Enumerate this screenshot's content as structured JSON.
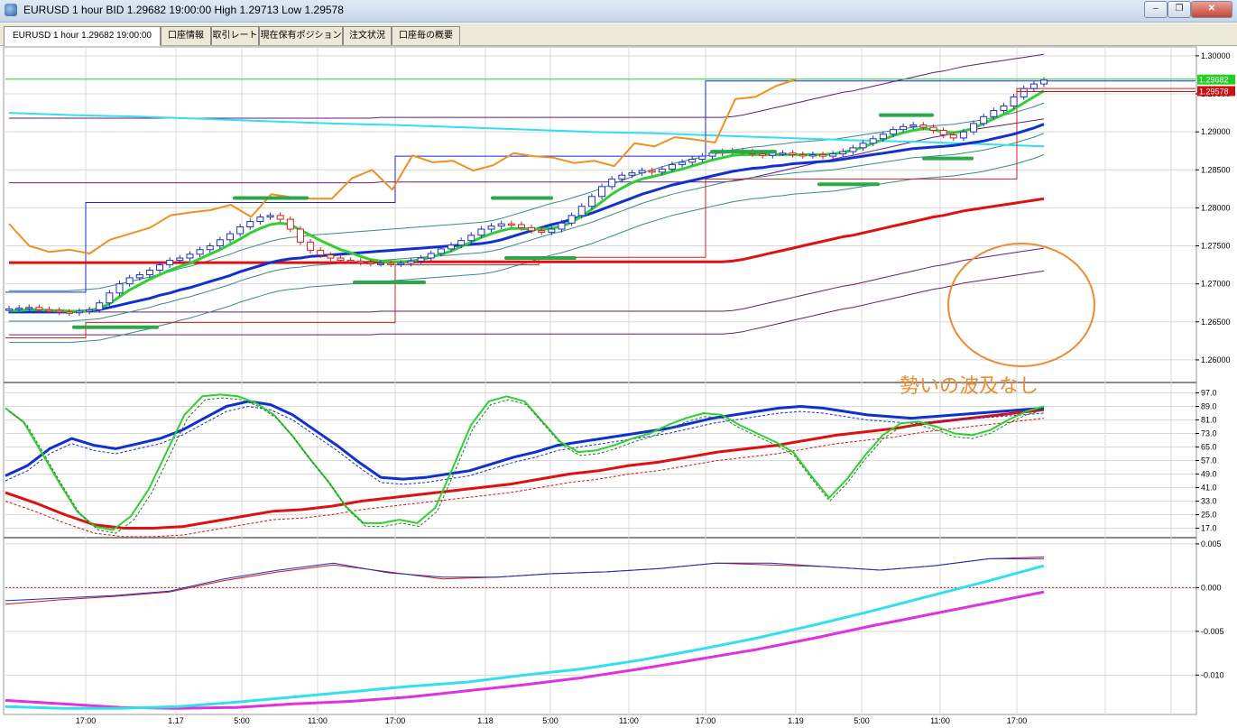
{
  "window": {
    "title": "EURUSD 1 hour BID 1.29682 19:00:00 High 1.29713 Low 1.29578",
    "minimize_icon": "minimize-icon",
    "restore_icon": "restore-icon",
    "close_icon": "close-icon"
  },
  "tabs": [
    {
      "label": "EURUSD 1 hour 1.29682 19:00:00",
      "active": true
    },
    {
      "label": "口座情報"
    },
    {
      "label": "取引レート"
    },
    {
      "label": "現在保有ポジション"
    },
    {
      "label": "注文状況"
    },
    {
      "label": "口座毎の概要"
    }
  ],
  "colors": {
    "background": "#ffffff",
    "grid": "#d8d8d8",
    "bull_candle": "#2030c8",
    "bear_candle": "#d02020",
    "price_line_green": "#20d020",
    "ask_line_red": "#d01010",
    "annotation": "#f08a30",
    "sma_fast": "#30d030",
    "sma_mid": "#1030d0",
    "sma_slow": "#e01010",
    "envelope": "#6a1a7a",
    "cyan": "#30e0f0",
    "magenta": "#e030e0",
    "chikou": "#f09020"
  },
  "annotation": {
    "text": "勢いの波及なし"
  },
  "chart_data": [
    {
      "type": "line",
      "panel": "price",
      "subtype": "candlestick",
      "symbol": "EURUSD",
      "timeframe": "1 hour",
      "last_close": 1.29682,
      "ask": 1.29578,
      "price_labels": [
        "1.29682",
        "1.29578"
      ],
      "ylim": [
        1.2575,
        1.3007
      ],
      "yticks": [
        "1.30000",
        "1.29500",
        "1.29000",
        "1.28500",
        "1.28000",
        "1.27500",
        "1.27000",
        "1.26500",
        "1.26000"
      ],
      "xticks": [
        "17:00",
        "1.17",
        "5:00",
        "11:00",
        "17:00",
        "1.18",
        "5:00",
        "11:00",
        "17:00",
        "1.19",
        "5:00",
        "11:00",
        "17:00"
      ],
      "candles_close": [
        1.2667,
        1.2668,
        1.2669,
        1.2666,
        1.2665,
        1.2663,
        1.2662,
        1.2664,
        1.2666,
        1.2675,
        1.2688,
        1.27,
        1.2708,
        1.2712,
        1.2718,
        1.2725,
        1.2731,
        1.2734,
        1.2739,
        1.2745,
        1.275,
        1.2758,
        1.2766,
        1.2775,
        1.2782,
        1.2788,
        1.279,
        1.2785,
        1.2772,
        1.2755,
        1.2744,
        1.2738,
        1.2734,
        1.2731,
        1.273,
        1.2728,
        1.2727,
        1.2727,
        1.2726,
        1.2727,
        1.273,
        1.2734,
        1.274,
        1.2746,
        1.2751,
        1.2757,
        1.2764,
        1.2772,
        1.2776,
        1.2779,
        1.2778,
        1.2774,
        1.277,
        1.2768,
        1.2772,
        1.278,
        1.279,
        1.2802,
        1.2815,
        1.2828,
        1.2838,
        1.2843,
        1.2846,
        1.2849,
        1.2847,
        1.2851,
        1.2857,
        1.286,
        1.2864,
        1.2868,
        1.2872,
        1.2874,
        1.2875,
        1.2874,
        1.2871,
        1.2869,
        1.2872,
        1.2872,
        1.287,
        1.2869,
        1.287,
        1.2868,
        1.2871,
        1.2874,
        1.2879,
        1.2885,
        1.2891,
        1.2897,
        1.2903,
        1.2907,
        1.2909,
        1.2906,
        1.2902,
        1.2896,
        1.2892,
        1.29,
        1.2911,
        1.292,
        1.2928,
        1.2934,
        1.2946,
        1.2957,
        1.2963,
        1.2968
      ],
      "series": [
        {
          "name": "fast",
          "color": "#30d030",
          "values": [
            1.2665,
            1.2665,
            1.2666,
            1.2666,
            1.2665,
            1.2665,
            1.2664,
            1.2664,
            1.2665,
            1.2668,
            1.2674,
            1.2683,
            1.2692,
            1.2699,
            1.2706,
            1.2712,
            1.2718,
            1.2723,
            1.2727,
            1.2733,
            1.2739,
            1.2745,
            1.2752,
            1.2759,
            1.2767,
            1.2773,
            1.2778,
            1.278,
            1.2778,
            1.2771,
            1.2764,
            1.2757,
            1.2751,
            1.2745,
            1.2741,
            1.2736,
            1.2732,
            1.273,
            1.2729,
            1.2729,
            1.273,
            1.2732,
            1.2735,
            1.2739,
            1.2743,
            1.2749,
            1.2755,
            1.2761,
            1.2766,
            1.277,
            1.2773,
            1.2773,
            1.2772,
            1.2772,
            1.2773,
            1.2776,
            1.2781,
            1.2789,
            1.2798,
            1.2808,
            1.2818,
            1.2826,
            1.2833,
            1.2838,
            1.2841,
            1.2844,
            1.2848,
            1.2851,
            1.2855,
            1.2859,
            1.2863,
            1.2866,
            1.2869,
            1.287,
            1.287,
            1.287,
            1.287,
            1.287,
            1.287,
            1.287,
            1.287,
            1.287,
            1.2871,
            1.2873,
            1.2876,
            1.288,
            1.2885,
            1.289,
            1.2895,
            1.2899,
            1.2902,
            1.2904,
            1.2903,
            1.29,
            1.2899,
            1.2901,
            1.2905,
            1.2911,
            1.2917,
            1.2923,
            1.293,
            1.2938,
            1.2946,
            1.2954
          ]
        },
        {
          "name": "mid",
          "color": "#1030d0",
          "values": [
            1.2663,
            1.2663,
            1.2663,
            1.2663,
            1.2663,
            1.2663,
            1.2663,
            1.2664,
            1.2665,
            1.2666,
            1.2669,
            1.2672,
            1.2675,
            1.2678,
            1.2681,
            1.2685,
            1.2688,
            1.2692,
            1.2695,
            1.2699,
            1.2703,
            1.2707,
            1.2711,
            1.2716,
            1.272,
            1.2724,
            1.2728,
            1.2731,
            1.2733,
            1.2734,
            1.2736,
            1.2737,
            1.2738,
            1.2739,
            1.274,
            1.2741,
            1.2742,
            1.2743,
            1.2744,
            1.2745,
            1.2746,
            1.2747,
            1.2748,
            1.2749,
            1.275,
            1.2751,
            1.2752,
            1.2753,
            1.2755,
            1.2758,
            1.2762,
            1.2766,
            1.277,
            1.2774,
            1.2778,
            1.2781,
            1.2785,
            1.2789,
            1.2793,
            1.2798,
            1.2803,
            1.2808,
            1.2813,
            1.2818,
            1.2822,
            1.2826,
            1.283,
            1.2833,
            1.2836,
            1.2839,
            1.2842,
            1.2845,
            1.2848,
            1.285,
            1.2852,
            1.2853,
            1.2855,
            1.2856,
            1.2858,
            1.2859,
            1.286,
            1.2861,
            1.2862,
            1.2864,
            1.2866,
            1.2868,
            1.287,
            1.2872,
            1.2874,
            1.2876,
            1.2878,
            1.2879,
            1.288,
            1.2881,
            1.2882,
            1.2884,
            1.2886,
            1.2888,
            1.2891,
            1.2894,
            1.2897,
            1.2901,
            1.2905,
            1.291
          ]
        },
        {
          "name": "slow",
          "color": "#e01010",
          "values": [
            1.2728,
            1.2728,
            1.2728,
            1.2728,
            1.2728,
            1.2728,
            1.2728,
            1.2728,
            1.2728,
            1.2728,
            1.2728,
            1.2728,
            1.2728,
            1.2728,
            1.2728,
            1.2728,
            1.2728,
            1.2728,
            1.2728,
            1.2728,
            1.2728,
            1.2728,
            1.2728,
            1.2728,
            1.2728,
            1.2728,
            1.2728,
            1.2728,
            1.2728,
            1.2728,
            1.2728,
            1.2728,
            1.2728,
            1.2728,
            1.2728,
            1.2728,
            1.2728,
            1.2729,
            1.2729,
            1.2729,
            1.2729,
            1.2729,
            1.2729,
            1.2729,
            1.2729,
            1.2729,
            1.2729,
            1.2729,
            1.2729,
            1.2729,
            1.2729,
            1.2729,
            1.2729,
            1.2729,
            1.2729,
            1.2729,
            1.2729,
            1.2729,
            1.2729,
            1.2729,
            1.2729,
            1.2729,
            1.2729,
            1.2729,
            1.2729,
            1.2729,
            1.2729,
            1.2729,
            1.2729,
            1.2729,
            1.2729,
            1.2729,
            1.273,
            1.2732,
            1.2735,
            1.2738,
            1.2741,
            1.2744,
            1.2747,
            1.275,
            1.2753,
            1.2756,
            1.2759,
            1.2762,
            1.2764,
            1.2767,
            1.277,
            1.2773,
            1.2776,
            1.2779,
            1.2782,
            1.2785,
            1.2788,
            1.279,
            1.2793,
            1.2796,
            1.2798,
            1.28,
            1.2802,
            1.2804,
            1.2806,
            1.2808,
            1.281,
            1.2812
          ]
        },
        {
          "name": "cyan",
          "color": "#30e0f0",
          "values": [
            1.2925,
            1.2922,
            1.292,
            1.2917,
            1.2914,
            1.2911,
            1.2909,
            1.2906,
            1.2903,
            1.29,
            1.2898,
            1.2895,
            1.2892,
            1.2889,
            1.2887,
            1.2884,
            1.2881
          ]
        },
        {
          "name": "chikou",
          "color": "#f09020",
          "values": [
            1.2779,
            1.275,
            1.2742,
            1.2745,
            1.274,
            1.2758,
            1.2766,
            1.2774,
            1.279,
            1.2794,
            1.2797,
            1.2804,
            1.2788,
            1.2818,
            1.2814,
            1.2812,
            1.2812,
            1.2839,
            1.285,
            1.2824,
            1.2869,
            1.286,
            1.2862,
            1.2849,
            1.2856,
            1.2872,
            1.2868,
            1.2866,
            1.2859,
            1.2862,
            1.2855,
            1.2885,
            1.2881,
            1.2893,
            1.289,
            1.2886,
            1.2943,
            1.2946,
            1.296,
            1.2969
          ]
        }
      ]
    },
    {
      "type": "line",
      "panel": "oscillator",
      "ylim": [
        13,
        101
      ],
      "yticks": [
        "97.0",
        "89.0",
        "81.0",
        "73.0",
        "65.0",
        "57.0",
        "49.0",
        "41.0",
        "33.0",
        "25.0",
        "17.0"
      ],
      "series": [
        {
          "color": "#30d030",
          "values": [
            88,
            80,
            62,
            44,
            27,
            18,
            16,
            24,
            40,
            62,
            84,
            95,
            96,
            95,
            91,
            84,
            72,
            58,
            45,
            30,
            20,
            20,
            22,
            20,
            29,
            53,
            78,
            92,
            95,
            92,
            80,
            68,
            62,
            63,
            66,
            70,
            73,
            78,
            82,
            85,
            84,
            78,
            73,
            68,
            62,
            48,
            35,
            46,
            60,
            72,
            79,
            80,
            77,
            73,
            72,
            75,
            81,
            86,
            89
          ]
        },
        {
          "color": "#1030d0",
          "values": [
            48,
            54,
            64,
            70,
            66,
            64,
            67,
            70,
            75,
            82,
            89,
            92,
            90,
            84,
            75,
            66,
            56,
            47,
            46,
            47,
            49,
            51,
            55,
            59,
            62,
            66,
            68,
            70,
            72,
            74,
            76,
            79,
            82,
            84,
            86,
            88,
            89,
            88,
            86,
            84,
            83,
            82,
            83,
            84,
            85,
            86,
            87,
            88
          ]
        },
        {
          "color": "#e01010",
          "values": [
            38,
            32,
            25,
            19,
            17,
            17,
            18,
            21,
            24,
            27,
            28,
            30,
            33,
            35,
            37,
            39,
            41,
            43,
            46,
            49,
            51,
            54,
            56,
            59,
            62,
            64,
            66,
            69,
            72,
            74,
            76,
            79,
            81,
            83,
            85,
            87
          ]
        }
      ]
    },
    {
      "type": "line",
      "panel": "macd",
      "ylim": [
        -0.0143,
        0.0053
      ],
      "yticks": [
        "0.005",
        "0.000",
        "-0.005",
        "-0.010"
      ],
      "series": [
        {
          "color": "#1030d0",
          "values": [
            -0.0015,
            -0.0012,
            -0.0009,
            -0.0004,
            0.001,
            0.002,
            0.0028,
            0.0017,
            0.0012,
            0.0012,
            0.0016,
            0.0018,
            0.0022,
            0.0028,
            0.0028,
            0.0024,
            0.002,
            0.0025,
            0.0033,
            0.0033
          ]
        },
        {
          "color": "#e01010",
          "values": [
            -0.0019,
            -0.0014,
            -0.001,
            -0.0005,
            0.0008,
            0.0018,
            0.0026,
            0.0018,
            0.001,
            0.0012,
            0.0016,
            0.0018,
            0.0022,
            0.0028,
            0.0026,
            0.0024,
            0.002,
            0.0025,
            0.0033,
            0.0035
          ]
        },
        {
          "color": "#30e0f0",
          "values": [
            -0.0136,
            -0.0138,
            -0.0138,
            -0.0136,
            -0.0131,
            -0.0125,
            -0.0119,
            -0.0113,
            -0.0108,
            -0.01,
            -0.0093,
            -0.0083,
            -0.0071,
            -0.0058,
            -0.0043,
            -0.0027,
            -0.001,
            0.0007,
            0.0025
          ]
        },
        {
          "color": "#e030e0",
          "values": [
            -0.0129,
            -0.0133,
            -0.0137,
            -0.0138,
            -0.0137,
            -0.0133,
            -0.013,
            -0.0125,
            -0.0118,
            -0.0111,
            -0.0103,
            -0.0093,
            -0.0082,
            -0.0071,
            -0.0058,
            -0.0044,
            -0.0031,
            -0.0018,
            -0.0005
          ]
        }
      ]
    }
  ]
}
